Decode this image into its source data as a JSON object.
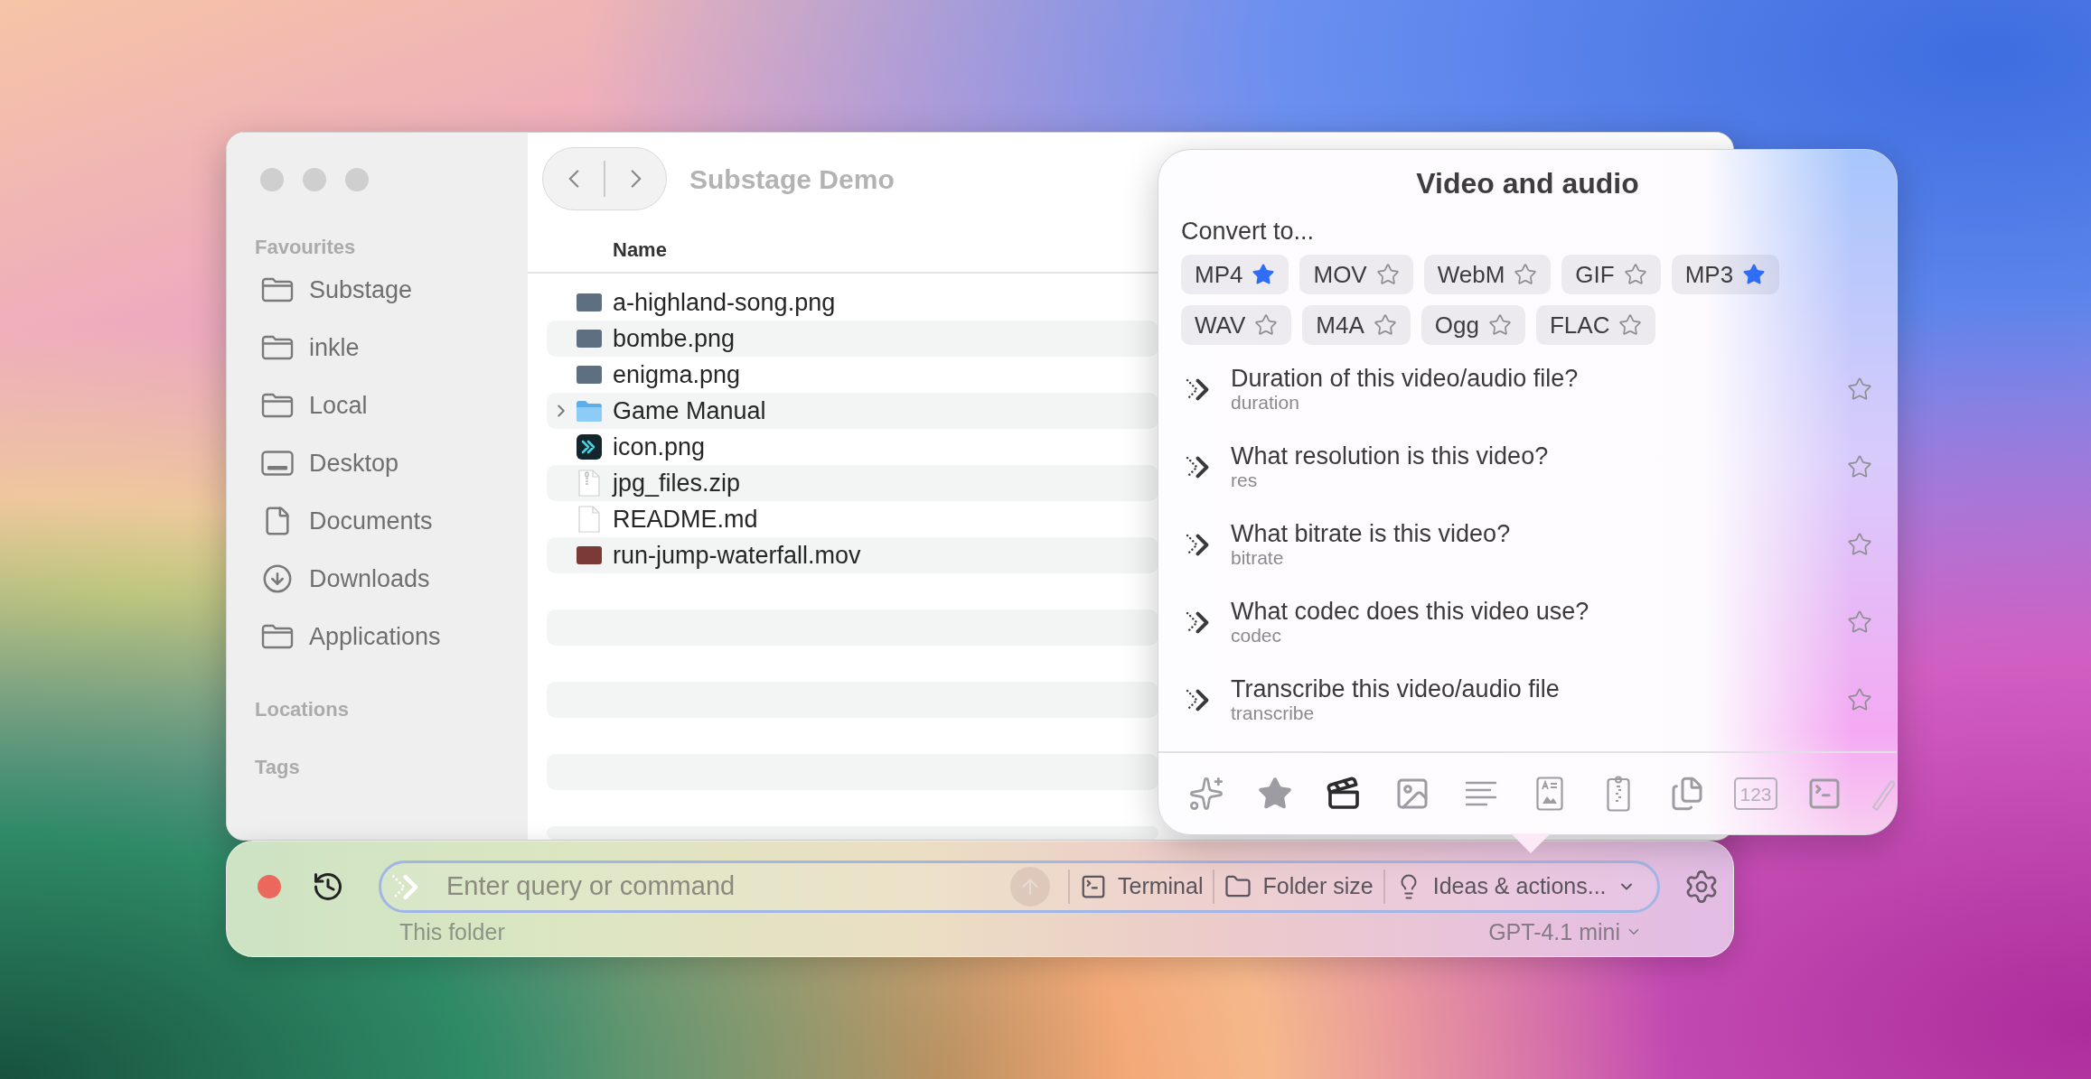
{
  "finder": {
    "window_title": "Substage Demo",
    "sidebar": {
      "sections": [
        {
          "heading": "Favourites",
          "items": [
            {
              "label": "Substage",
              "kind": "folder"
            },
            {
              "label": "inkle",
              "kind": "folder"
            },
            {
              "label": "Local",
              "kind": "folder"
            },
            {
              "label": "Desktop",
              "kind": "desktop"
            },
            {
              "label": "Documents",
              "kind": "document"
            },
            {
              "label": "Downloads",
              "kind": "downloads"
            },
            {
              "label": "Applications",
              "kind": "folder"
            }
          ]
        },
        {
          "heading": "Locations"
        },
        {
          "heading": "Tags"
        }
      ]
    },
    "file_list": {
      "column_header": "Name",
      "rows": [
        {
          "name": "a-highland-song.png",
          "kind": "image"
        },
        {
          "name": "bombe.png",
          "kind": "image"
        },
        {
          "name": "enigma.png",
          "kind": "image"
        },
        {
          "name": "Game Manual",
          "kind": "folder",
          "expanded": false
        },
        {
          "name": "icon.png",
          "kind": "app-icon"
        },
        {
          "name": "jpg_files.zip",
          "kind": "archive"
        },
        {
          "name": "README.md",
          "kind": "document"
        },
        {
          "name": "run-jump-waterfall.mov",
          "kind": "video"
        }
      ]
    }
  },
  "popup": {
    "title": "Video and audio",
    "convert_label": "Convert to...",
    "formats": [
      {
        "label": "MP4",
        "starred": true
      },
      {
        "label": "MOV",
        "starred": false
      },
      {
        "label": "WebM",
        "starred": false
      },
      {
        "label": "GIF",
        "starred": false
      },
      {
        "label": "MP3",
        "starred": true
      },
      {
        "label": "WAV",
        "starred": false
      },
      {
        "label": "M4A",
        "starred": false
      },
      {
        "label": "Ogg",
        "starred": false
      },
      {
        "label": "FLAC",
        "starred": false
      }
    ],
    "actions": [
      {
        "title": "Duration of this video/audio file?",
        "command": "duration",
        "starred": false
      },
      {
        "title": "What resolution is this video?",
        "command": "res",
        "starred": false
      },
      {
        "title": "What bitrate is this video?",
        "command": "bitrate",
        "starred": false
      },
      {
        "title": "What codec does this video use?",
        "command": "codec",
        "starred": false
      },
      {
        "title": "Transcribe this video/audio file",
        "command": "transcribe",
        "starred": false
      }
    ],
    "categories": [
      {
        "kind": "sparkles",
        "selected": false
      },
      {
        "kind": "favourites",
        "selected": false
      },
      {
        "kind": "video",
        "selected": true
      },
      {
        "kind": "image",
        "selected": false
      },
      {
        "kind": "text",
        "selected": false
      },
      {
        "kind": "text-image-document",
        "selected": false
      },
      {
        "kind": "archive",
        "selected": false
      },
      {
        "kind": "files",
        "selected": false
      },
      {
        "kind": "numbers",
        "glyph": "123",
        "selected": false
      },
      {
        "kind": "terminal",
        "selected": false
      },
      {
        "kind": "wand",
        "selected": false
      }
    ]
  },
  "command_bar": {
    "query": {
      "placeholder": "Enter query or command"
    },
    "send_button": {
      "disabled": true
    },
    "tools": [
      {
        "kind": "terminal",
        "label": "Terminal"
      },
      {
        "kind": "folder-size",
        "label": "Folder size"
      },
      {
        "kind": "ideas",
        "label": "Ideas & actions..."
      }
    ],
    "scope": "This folder",
    "model": "GPT-4.1 mini"
  }
}
